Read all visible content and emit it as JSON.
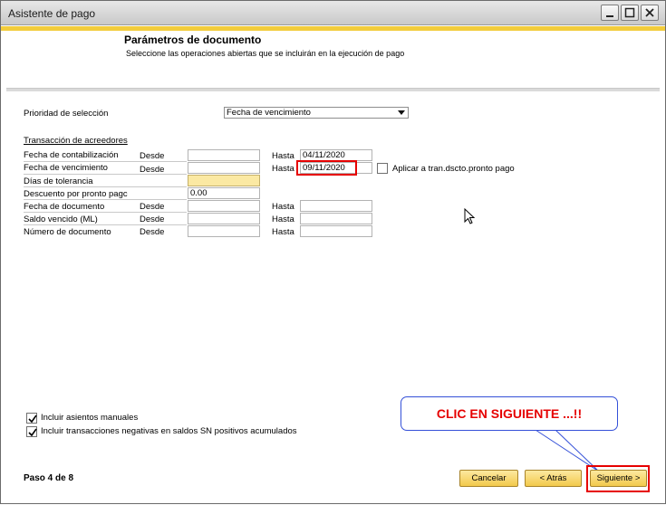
{
  "window": {
    "title": "Asistente de pago"
  },
  "header": {
    "title": "Parámetros de documento",
    "subtitle": "Seleccione las operaciones abiertas que se incluirán en la ejecución de pago"
  },
  "form": {
    "priority_label": "Prioridad de selección",
    "priority_value": "Fecha de vencimiento",
    "section_title": "Transacción de acreedores",
    "rows": [
      {
        "label": "Fecha de contabilización",
        "desde": "Desde",
        "desde_value": "",
        "hasta": "Hasta",
        "hasta_value": "04/11/2020"
      },
      {
        "label": "Fecha de vencimiento",
        "desde": "Desde",
        "desde_value": "",
        "hasta": "Hasta",
        "hasta_value": "09/11/2020"
      },
      {
        "label": "Días de tolerancia",
        "value": ""
      },
      {
        "label": "Descuento por pronto pagc",
        "value": "0.00"
      },
      {
        "label": "Fecha de documento",
        "desde": "Desde",
        "desde_value": "",
        "hasta": "Hasta",
        "hasta_value": ""
      },
      {
        "label": "Saldo vencido (ML)",
        "desde": "Desde",
        "desde_value": "",
        "hasta": "Hasta",
        "hasta_value": ""
      },
      {
        "label": "Número de documento",
        "desde": "Desde",
        "desde_value": "",
        "hasta": "Hasta",
        "hasta_value": ""
      }
    ],
    "apply_discount_label": "Aplicar a tran.dscto.pronto pago",
    "apply_discount_checked": false
  },
  "options": {
    "manual_entries_label": "Incluir asientos manuales",
    "manual_entries_checked": true,
    "negative_tx_label": "Incluir transacciones negativas en saldos SN positivos acumulados",
    "negative_tx_checked": true
  },
  "footer": {
    "step": "Paso 4 de 8",
    "cancel_label": "Cancelar",
    "back_label": "< Atrás",
    "next_label": "Siguiente >"
  },
  "annotation": {
    "callout_text": "CLIC EN SIGUIENTE ...!!"
  },
  "colors": {
    "accent": "#f2cc3c",
    "button": "#f2c94c",
    "highlight": "#e60000",
    "callout_border": "#3450d8"
  }
}
